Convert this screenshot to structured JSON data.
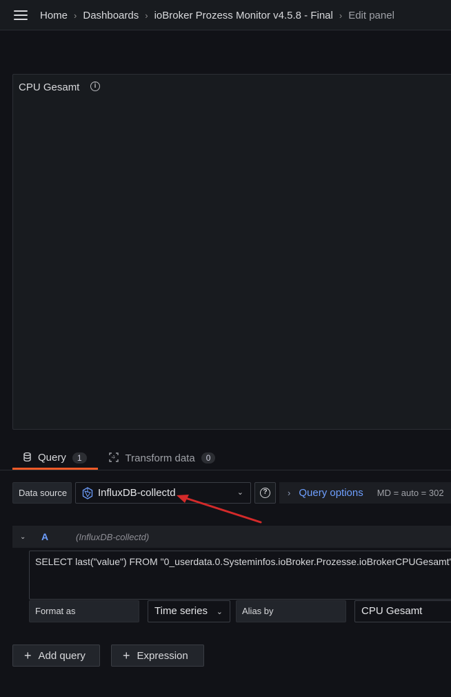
{
  "header": {
    "breadcrumbs": [
      "Home",
      "Dashboards",
      "ioBroker Prozess Monitor v4.5.8 - Final",
      "Edit panel"
    ]
  },
  "panel": {
    "title": "CPU Gesamt"
  },
  "tabs": [
    {
      "label": "Query",
      "count": "1"
    },
    {
      "label": "Transform data",
      "count": "0"
    }
  ],
  "datasource": {
    "label": "Data source",
    "value": "InfluxDB-collectd"
  },
  "query_options": {
    "label": "Query options",
    "summary": "MD = auto = 302"
  },
  "query": {
    "name": "A",
    "datasource_hint": "(InfluxDB-collectd)",
    "sql": "SELECT last(\"value\") FROM \"0_userdata.0.Systeminfos.ioBroker.Prozesse.ioBrokerCPUGesamt\"",
    "format_label": "Format as",
    "format_value": "Time series",
    "alias_label": "Alias by",
    "alias_value": "CPU Gesamt"
  },
  "buttons": {
    "add_query": "Add query",
    "expression": "Expression"
  },
  "colors": {
    "accent_orange": "#f05a28",
    "link_blue": "#6e9fff",
    "annotation_arrow": "#d42a2a"
  }
}
